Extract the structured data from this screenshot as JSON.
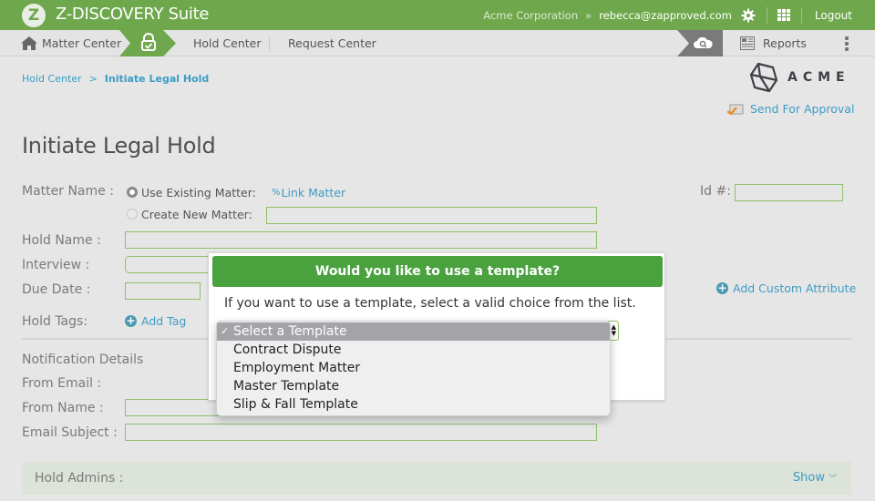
{
  "topbar": {
    "logo_letter": "Z",
    "app_title": "Z-DISCOVERY Suite",
    "organization": "Acme Corporation",
    "separator": "»",
    "user_email": "rebecca@zapproved.com",
    "logout_label": "Logout"
  },
  "nav": {
    "matter_center": "Matter Center",
    "hold_center": "Hold Center",
    "request_center": "Request Center",
    "reports": "Reports"
  },
  "breadcrumb": {
    "parent": "Hold Center",
    "separator": ">",
    "current": "Initiate Legal Hold"
  },
  "brand": {
    "logo_text": "ACME"
  },
  "actions": {
    "send_for_approval": "Send For Approval",
    "add_custom_attribute": "Add Custom Attribute"
  },
  "page": {
    "title": "Initiate Legal Hold"
  },
  "form": {
    "matter_name_label": "Matter Name :",
    "use_existing_label": "Use Existing Matter:",
    "use_existing_checked": true,
    "link_matter_label": "Link Matter",
    "create_new_label": "Create New Matter:",
    "create_new_checked": false,
    "create_new_value": "",
    "id_label": "Id #:",
    "id_value": "",
    "hold_name_label": "Hold Name :",
    "hold_name_value": "",
    "interview_label": "Interview :",
    "due_date_label": "Due Date :",
    "due_date_value": "",
    "hold_tags_label": "Hold Tags:",
    "add_tag_label": "Add Tag"
  },
  "notification": {
    "section_title": "Notification Details",
    "from_email_label": "From Email :",
    "from_name_label": "From Name :",
    "from_name_value": "",
    "email_subject_label": "Email Subject :",
    "email_subject_value": ""
  },
  "admins": {
    "label": "Hold Admins :",
    "toggle_label": "Show",
    "toggle_icon": "»"
  },
  "dialog": {
    "title": "Would you like to use a template?",
    "message": "If you want to use a template, select a valid choice from the list.",
    "select": {
      "selected": "Select a Template",
      "check_mark": "✓",
      "options": [
        "Select a Template",
        "Contract Dispute",
        "Employment Matter",
        "Master Template",
        "Slip & Fall Template"
      ]
    }
  },
  "colors": {
    "brand_green": "#6fa84c",
    "dialog_green": "#4aa23f",
    "link_blue": "#3d9cc4",
    "field_border": "#8fc06a"
  }
}
